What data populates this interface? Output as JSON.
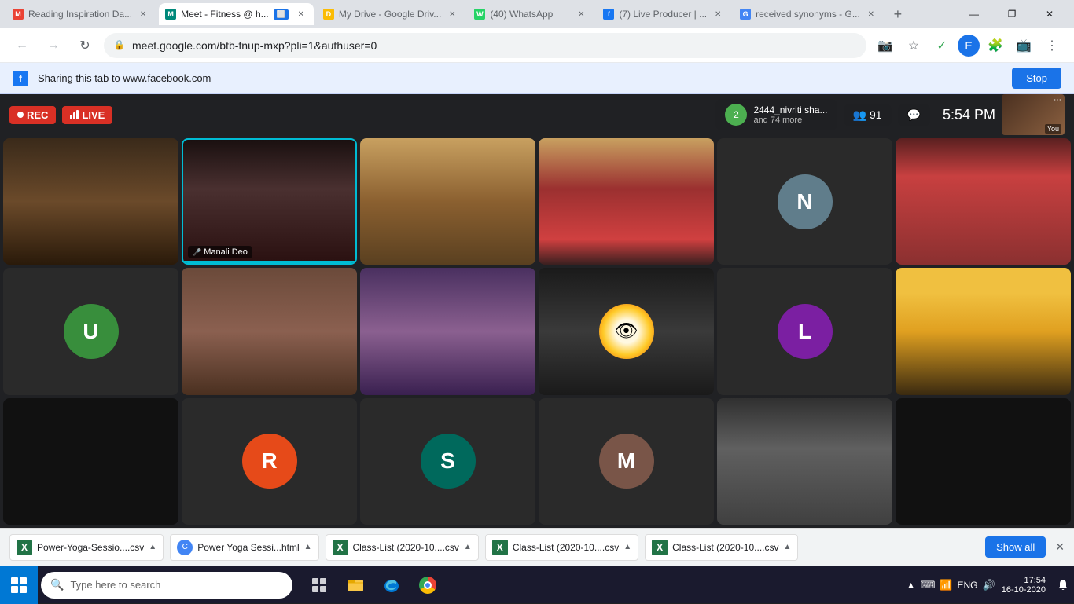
{
  "browser": {
    "tabs": [
      {
        "id": "tab1",
        "title": "Reading Inspiration Da...",
        "favicon_color": "#ea4335",
        "favicon_letter": "M",
        "active": false
      },
      {
        "id": "tab2",
        "title": "Meet - Fitness @ h...",
        "favicon_color": "#00897b",
        "favicon_letter": "M",
        "active": true
      },
      {
        "id": "tab3",
        "title": "My Drive - Google Driv...",
        "favicon_color": "#fbbc04",
        "favicon_letter": "D",
        "active": false
      },
      {
        "id": "tab4",
        "title": "(40) WhatsApp",
        "favicon_color": "#25d366",
        "favicon_letter": "W",
        "badge": "40",
        "active": false
      },
      {
        "id": "tab5",
        "title": "(7) Live Producer | ...",
        "favicon_color": "#1877f2",
        "favicon_letter": "f",
        "badge": "7",
        "active": false
      },
      {
        "id": "tab6",
        "title": "received synonyms - G...",
        "favicon_color": "#4285f4",
        "favicon_letter": "G",
        "active": false
      }
    ],
    "address": "meet.google.com/btb-fnup-mxp?pli=1&authuser=0",
    "window_controls": {
      "minimize": "—",
      "maximize": "❐",
      "close": "✕"
    }
  },
  "sharing_banner": {
    "text": "Sharing this tab to www.facebook.com",
    "stop_label": "Stop",
    "icon_letter": "f"
  },
  "meet": {
    "rec_label": "REC",
    "live_label": "LIVE",
    "participant_name": "2444_nivriti sha...",
    "participant_subtitle": "and 74 more",
    "participant_count": "91",
    "time": "5:54 PM",
    "self_label": "You",
    "participants": [
      {
        "id": "p1",
        "type": "video",
        "name": "",
        "col": 1,
        "row": 1,
        "bg": "#3c4043"
      },
      {
        "id": "p2",
        "type": "video",
        "name": "Manali Deo",
        "col": 2,
        "row": 1,
        "bg": "#2a2a2a",
        "has_speaking": true
      },
      {
        "id": "p3",
        "type": "video",
        "name": "",
        "col": 3,
        "row": 1,
        "bg": "#3c4043"
      },
      {
        "id": "p4",
        "type": "video",
        "name": "",
        "col": 4,
        "row": 1,
        "bg": "#2a2a2a"
      },
      {
        "id": "p5",
        "type": "avatar",
        "letter": "N",
        "color": "#607d8b",
        "col": 5,
        "row": 1
      },
      {
        "id": "p6",
        "type": "video",
        "name": "",
        "col": 6,
        "row": 1,
        "bg": "#3c4043"
      },
      {
        "id": "p7",
        "type": "avatar",
        "letter": "U",
        "color": "#388e3c",
        "col": 1,
        "row": 2
      },
      {
        "id": "p8",
        "type": "video",
        "name": "",
        "col": 2,
        "row": 2,
        "bg": "#3c4043"
      },
      {
        "id": "p9",
        "type": "video",
        "name": "",
        "col": 3,
        "row": 2,
        "bg": "#3c4043"
      },
      {
        "id": "p10",
        "type": "video",
        "name": "",
        "col": 4,
        "row": 2,
        "bg": "#3c4043"
      },
      {
        "id": "p11",
        "type": "avatar",
        "letter": "L",
        "color": "#7b1fa2",
        "col": 5,
        "row": 2
      },
      {
        "id": "p12",
        "type": "video",
        "name": "",
        "col": 6,
        "row": 2,
        "bg": "#3c4043"
      },
      {
        "id": "p13",
        "type": "video",
        "name": "",
        "col": 1,
        "row": 3,
        "bg": "#1a1a1a"
      },
      {
        "id": "p14",
        "type": "avatar",
        "letter": "R",
        "color": "#e64a19",
        "col": 2,
        "row": 3
      },
      {
        "id": "p15",
        "type": "avatar",
        "letter": "S",
        "color": "#00695c",
        "col": 3,
        "row": 3
      },
      {
        "id": "p16",
        "type": "avatar",
        "letter": "M",
        "color": "#795548",
        "col": 4,
        "row": 3
      },
      {
        "id": "p17",
        "type": "video",
        "name": "",
        "col": 5,
        "row": 3,
        "bg": "#3c4043"
      },
      {
        "id": "p18",
        "type": "empty",
        "col": 6,
        "row": 3,
        "bg": "#1a1a1a"
      }
    ]
  },
  "downloads": [
    {
      "id": "dl1",
      "name": "Power-Yoga-Sessio....csv",
      "icon_color": "#217346",
      "icon_letter": "X"
    },
    {
      "id": "dl2",
      "name": "Power Yoga Sessi...html",
      "icon_color": "#4285f4",
      "icon_letter": "C"
    },
    {
      "id": "dl3",
      "name": "Class-List (2020-10....csv",
      "icon_color": "#217346",
      "icon_letter": "X"
    },
    {
      "id": "dl4",
      "name": "Class-List (2020-10....csv",
      "icon_color": "#217346",
      "icon_letter": "X"
    },
    {
      "id": "dl5",
      "name": "Class-List (2020-10....csv",
      "icon_color": "#217346",
      "icon_letter": "X"
    }
  ],
  "show_all_label": "Show all",
  "taskbar": {
    "search_placeholder": "Type here to search",
    "tray_time": "17:54",
    "tray_date": "16-10-2020",
    "lang": "ENG"
  }
}
